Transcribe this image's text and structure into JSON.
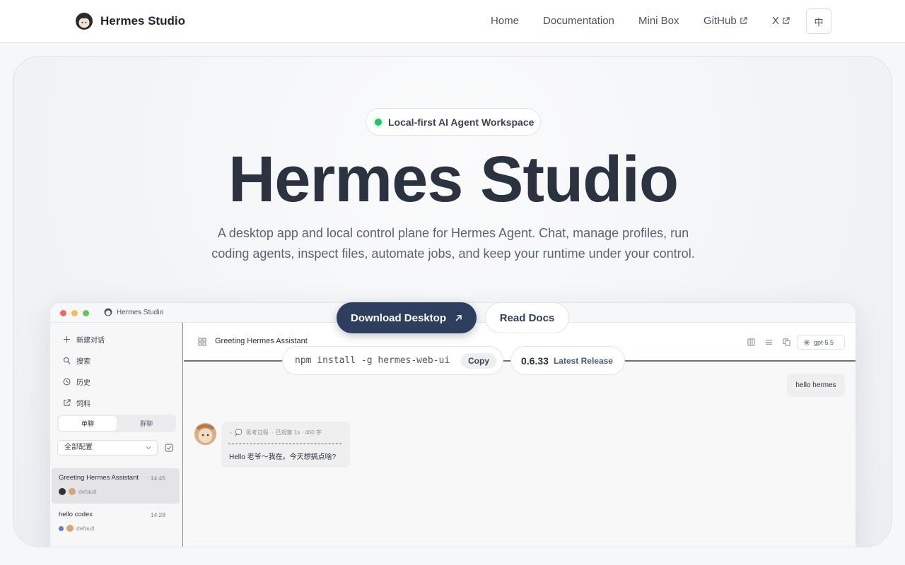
{
  "nav": {
    "brand": "Hermes Studio",
    "links": [
      "Home",
      "Documentation",
      "Mini Box",
      "GitHub",
      "X"
    ],
    "lang": "中"
  },
  "hero": {
    "badge": "Local-first AI Agent Workspace",
    "title": "Hermes Studio",
    "subtitle": "A desktop app and local control plane for Hermes Agent. Chat, manage profiles, run coding agents, inspect files, automate jobs, and keep your runtime under your control.",
    "download_label": "Download Desktop",
    "docs_label": "Read Docs",
    "install_cmd": "npm install -g hermes-web-ui",
    "copy_label": "Copy",
    "version": "0.6.33",
    "version_label": "Latest Release"
  },
  "mock": {
    "app_title": "Hermes Studio",
    "sidebar": {
      "items": [
        "新建对话",
        "搜索",
        "历史",
        "饲料"
      ],
      "seg_a": "单聊",
      "seg_b": "群聊",
      "select_value": "全部配置",
      "conversations": [
        {
          "title": "Greeting Hermes Assistant",
          "time": "14:45",
          "tag": "default"
        },
        {
          "title": "hello codex",
          "time": "14:28",
          "tag": "default"
        }
      ]
    },
    "chat": {
      "title": "Greeting Hermes Assistant",
      "model": "gpt-5.5",
      "user_msg": "hello hermes",
      "bot_meta_a": "思考过程",
      "bot_meta_b": "· 已观察 1s · 400 字",
      "bot_msg": "Hello 老爷～我在。今天想搞点啥?"
    }
  },
  "colors": {
    "accent": "#2e3e5f",
    "status_dot": "#22c55e",
    "title": "#2b3340"
  }
}
